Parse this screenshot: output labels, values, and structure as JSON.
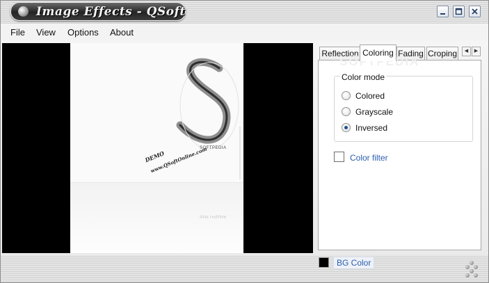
{
  "window": {
    "title": "Image Effects - QSoft",
    "controls": {
      "minimize": "minimize-icon",
      "maximize": "maximize-icon",
      "close": "close-icon"
    }
  },
  "menu": {
    "items": [
      {
        "label": "File"
      },
      {
        "label": "View"
      },
      {
        "label": "Options"
      },
      {
        "label": "About"
      }
    ]
  },
  "preview": {
    "demo_text": "DEMO",
    "demo_url": "www.QSoftOnline.com",
    "watermark": "SOFTPEDIA"
  },
  "tabs": {
    "items": [
      {
        "label": "Reflection",
        "active": false
      },
      {
        "label": "Coloring",
        "active": true
      },
      {
        "label": "Fading",
        "active": false
      },
      {
        "label": "Croping",
        "active": false
      }
    ]
  },
  "coloring": {
    "panel_watermark": "SOFTPEDIA",
    "panel_watermark_url": "www.softpedia.com",
    "group_title": "Color mode",
    "options": [
      {
        "label": "Colored",
        "checked": false
      },
      {
        "label": "Grayscale",
        "checked": false
      },
      {
        "label": "Inversed",
        "checked": true
      }
    ],
    "color_filter_label": "Color filter",
    "color_filter_checked": false
  },
  "bottom": {
    "bg_color_label": "BG Color",
    "bg_color_value": "#000000"
  },
  "colors": {
    "title_bar": "#242424",
    "accent_link": "#2a5db0",
    "radio_dot": "#1b4f8a"
  }
}
